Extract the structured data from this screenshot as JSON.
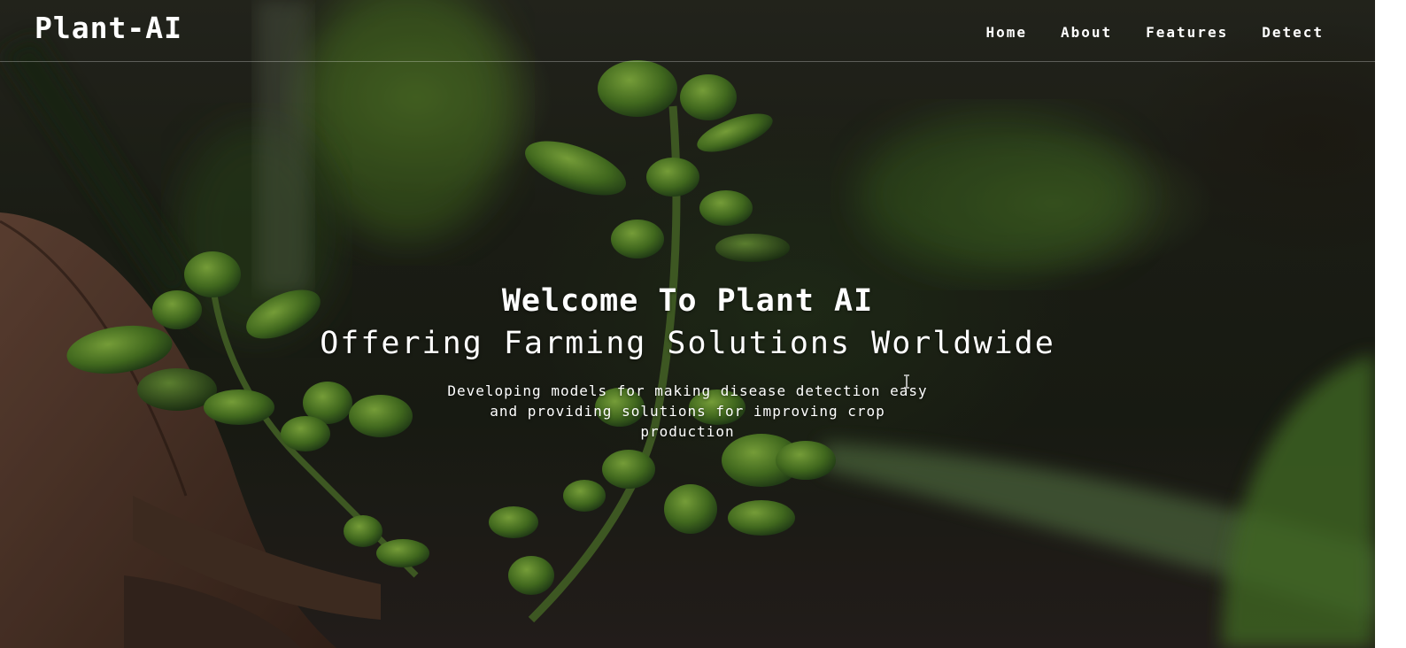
{
  "nav": {
    "brand": "Plant-AI",
    "links": [
      {
        "label": "Home"
      },
      {
        "label": "About"
      },
      {
        "label": "Features"
      },
      {
        "label": "Detect"
      }
    ]
  },
  "hero": {
    "title": "Welcome To Plant AI",
    "subtitle": "Offering Farming Solutions Worldwide",
    "description": "Developing models for making disease detection easy and providing solutions for improving crop production"
  },
  "icons": {
    "cursor": "text-cursor-icon"
  },
  "colors": {
    "text": "#ffffff",
    "leaf_green": "#5d8a2f",
    "background_dark": "#1f2218"
  }
}
